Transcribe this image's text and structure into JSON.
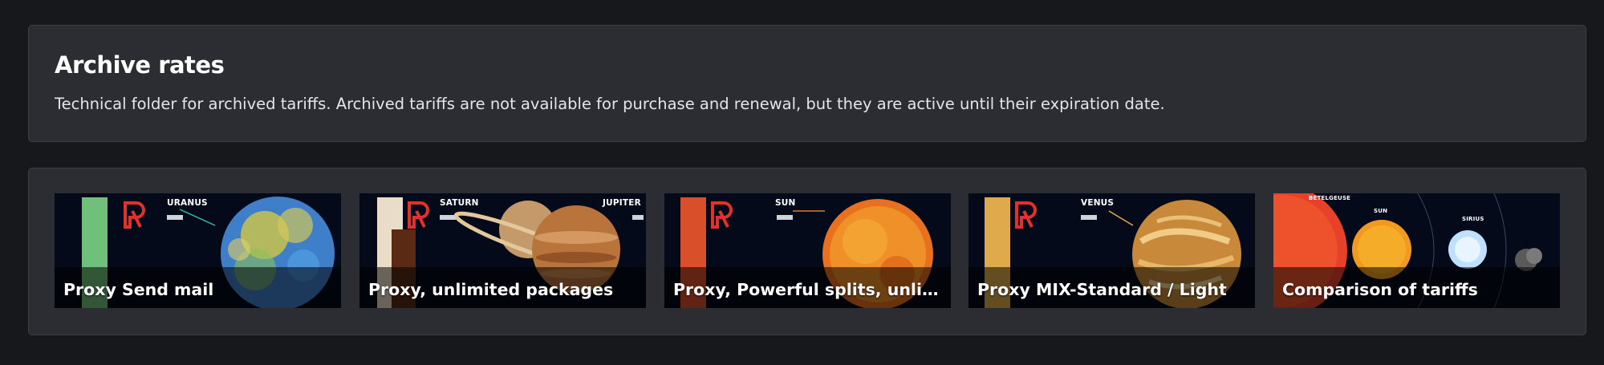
{
  "header": {
    "title": "Archive rates",
    "description": "Technical folder for archived tariffs. Archived tariffs are not available for purchase and renewal, but they are active until their expiration date."
  },
  "cards": [
    {
      "caption": "Proxy Send mail",
      "planet_labels": [
        "URANUS"
      ],
      "accent": "#6fc07a",
      "icon": "uranus-planet-image"
    },
    {
      "caption": "Proxy, unlimited packages",
      "planet_labels": [
        "SATURN",
        "JUPITER"
      ],
      "accent": "#e9dcc8",
      "icon": "saturn-jupiter-image"
    },
    {
      "caption": "Proxy, Powerful splits, unlimited",
      "planet_labels": [
        "SUN"
      ],
      "accent": "#d84f2a",
      "icon": "sun-image"
    },
    {
      "caption": "Proxy MIX-Standard / Light",
      "planet_labels": [
        "VENUS"
      ],
      "accent": "#dfaa4c",
      "icon": "venus-image"
    },
    {
      "caption": "Comparison of tariffs",
      "planet_labels": [
        "BETELGEUSE",
        "SUN",
        "SIRIUS"
      ],
      "accent": "#e8412b",
      "icon": "star-comparison-image"
    }
  ],
  "colors": {
    "background": "#17181b",
    "panel": "#2c2d32",
    "logo": "#e0322a"
  }
}
